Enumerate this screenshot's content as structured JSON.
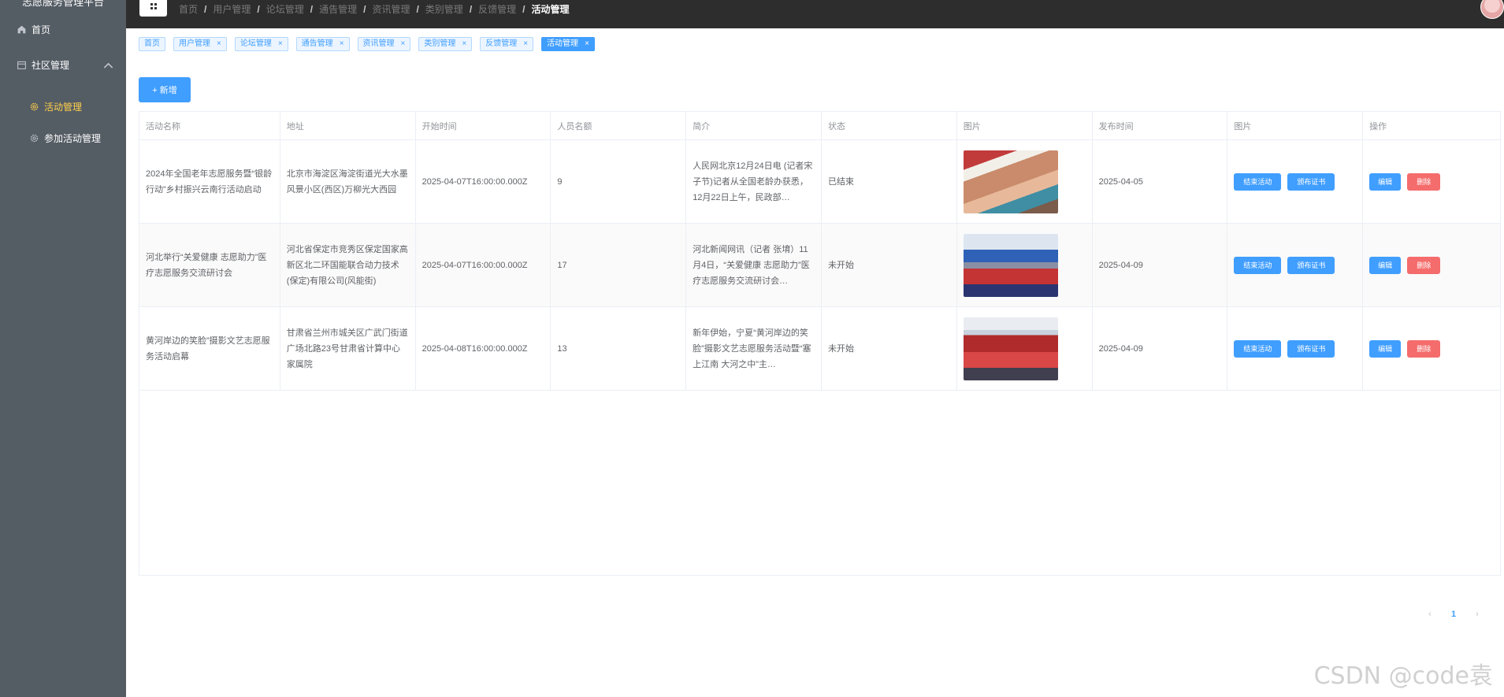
{
  "sidebar": {
    "brand": "志愿服务管理平台",
    "home": "首页",
    "community": "社区管理",
    "activity": "活动管理",
    "join_activity": "参加活动管理"
  },
  "breadcrumb": [
    "首页",
    "用户管理",
    "论坛管理",
    "通告管理",
    "资讯管理",
    "类别管理",
    "反馈管理",
    "活动管理"
  ],
  "tags": [
    {
      "label": "首页",
      "closable": false
    },
    {
      "label": "用户管理",
      "closable": true
    },
    {
      "label": "论坛管理",
      "closable": true
    },
    {
      "label": "通告管理",
      "closable": true
    },
    {
      "label": "资讯管理",
      "closable": true
    },
    {
      "label": "类别管理",
      "closable": true
    },
    {
      "label": "反馈管理",
      "closable": true
    },
    {
      "label": "活动管理",
      "closable": true,
      "active": true
    }
  ],
  "add_button": "+ 新增",
  "table": {
    "headers": [
      "活动名称",
      "地址",
      "开始时间",
      "人员名额",
      "简介",
      "状态",
      "图片",
      "发布时间",
      "图片",
      "操作"
    ],
    "rows": [
      {
        "name": "2024年全国老年志愿服务暨“银龄行动”乡村振兴云南行活动启动",
        "address": "北京市海淀区海淀街道光大水墨风景小区(西区)万柳光大西园",
        "start": "2025-04-07T16:00:00.000Z",
        "quota": "9",
        "intro": "人民网北京12月24日电 (记者宋子节)记者从全国老龄办获悉，12月22日上午，民政部…",
        "status": "已结束",
        "publish": "2025-04-05"
      },
      {
        "name": "河北举行“关爱健康 志愿助力”医疗志愿服务交流研讨会",
        "address": "河北省保定市竞秀区保定国家高新区北二环国能联合动力技术(保定)有限公司(风能街)",
        "start": "2025-04-07T16:00:00.000Z",
        "quota": "17",
        "intro": "河北新闻网讯（记者 张堉）11月4日，“关爱健康 志愿助力”医疗志愿服务交流研讨会…",
        "status": "未开始",
        "publish": "2025-04-09"
      },
      {
        "name": "黄河岸边的笑脸”摄影文艺志愿服务活动启幕",
        "address": "甘肃省兰州市城关区广武门街道广场北路23号甘肃省计算中心家属院",
        "start": "2025-04-08T16:00:00.000Z",
        "quota": "13",
        "intro": "新年伊始，宁夏“黄河岸边的笑脸”摄影文艺志愿服务活动暨“塞上江南 大河之中”主…",
        "status": "未开始",
        "publish": "2025-04-09"
      }
    ],
    "actions": {
      "end": "结束活动",
      "certificate": "颁布证书",
      "edit": "编辑",
      "delete": "删除"
    }
  },
  "pagination": {
    "prev": "‹",
    "page": "1",
    "next": "›"
  },
  "watermark": "CSDN @code袁"
}
